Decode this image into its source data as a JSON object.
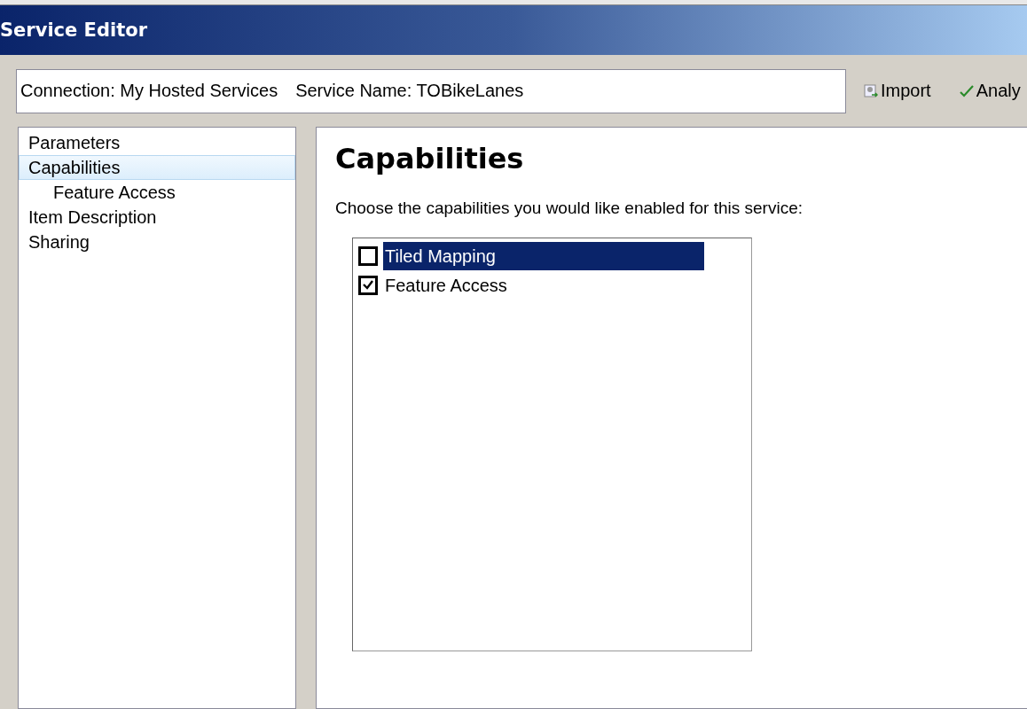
{
  "window": {
    "title": "Service Editor"
  },
  "header": {
    "connection_label": "Connection: My Hosted Services",
    "service_label": "Service Name: TOBikeLanes"
  },
  "toolbar": [
    {
      "kind": "import",
      "label": "Import"
    },
    {
      "kind": "analyze",
      "label": "Analy"
    }
  ],
  "sidebar": {
    "items": [
      {
        "label": "Parameters",
        "selected": false
      },
      {
        "label": "Capabilities",
        "selected": true,
        "children": [
          {
            "label": "Feature Access",
            "selected": false
          }
        ]
      },
      {
        "label": "Item Description",
        "selected": false
      },
      {
        "label": "Sharing",
        "selected": false
      }
    ]
  },
  "content": {
    "heading": "Capabilities",
    "prompt": "Choose the capabilities you would like enabled for this service:",
    "capabilities": [
      {
        "label": "Tiled Mapping",
        "checked": false,
        "selected": true
      },
      {
        "label": "Feature Access",
        "checked": true,
        "selected": false
      }
    ]
  }
}
